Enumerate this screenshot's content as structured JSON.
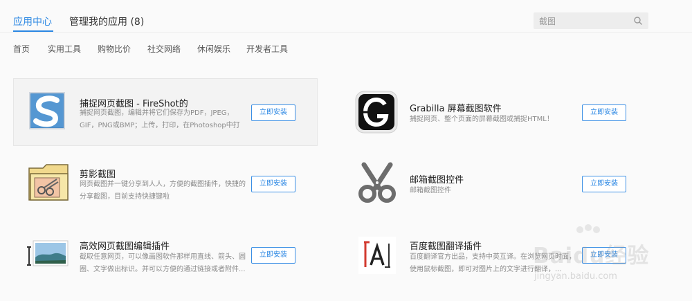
{
  "tabs": {
    "app_center": "应用中心",
    "my_apps": "管理我的应用 (8)"
  },
  "search": {
    "value": "截图",
    "icon": "search-icon"
  },
  "nav": [
    "首页",
    "实用工具",
    "购物比价",
    "社交网络",
    "休闲娱乐",
    "开发者工具"
  ],
  "apps": [
    {
      "name": "捕捉网页截图 - FireShot的",
      "desc": "捕捉网页截图，编辑并将它们保存为PDF，JPEG，GIF，PNG或BMP；上传，打印，在Photoshop中打开，复制...",
      "button": "立即安装",
      "icon": "fireshot-icon"
    },
    {
      "name": "Grabilla 屏幕截图软件",
      "desc": "捕捉网页、整个页面的屏幕截图或捕捉HTML！",
      "button": "立即安装",
      "icon": "grabilla-icon"
    },
    {
      "name": "剪影截图",
      "desc": "网页截图并一键分享到人人，方便的截图插件，快捷的分享截图，目前支持快捷键啦",
      "button": "立即安装",
      "icon": "folder-scissors-icon"
    },
    {
      "name": "邮箱截图控件",
      "desc": "邮箱截图控件",
      "button": "立即安装",
      "icon": "scissors-icon"
    },
    {
      "name": "高效网页截图编辑插件",
      "desc": "截取任意网页，可以像画图软件那样用直线、箭头、圆圈、文字做出标识。并可以方便的通过链接或者附件...",
      "button": "立即安装",
      "icon": "image-editor-icon"
    },
    {
      "name": "百度截图翻译插件",
      "desc": "百度翻译官方出品，支持中英互译。在浏览网页时面，使用鼠标截图，即可对图片上的文字进行翻译，...",
      "button": "立即安装",
      "icon": "translate-a-icon"
    }
  ],
  "watermark": {
    "text": "Baidu经验",
    "url": "jingyan.baidu.com"
  }
}
